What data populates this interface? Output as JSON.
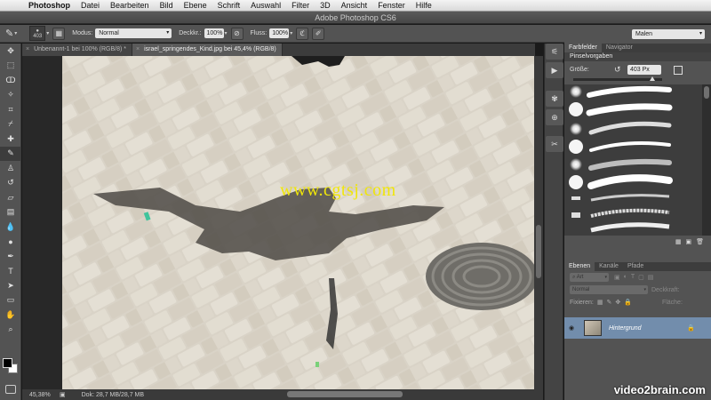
{
  "menubar": {
    "items": [
      {
        "label": "Photoshop"
      },
      {
        "label": "Datei"
      },
      {
        "label": "Bearbeiten"
      },
      {
        "label": "Bild"
      },
      {
        "label": "Ebene"
      },
      {
        "label": "Schrift"
      },
      {
        "label": "Auswahl"
      },
      {
        "label": "Filter"
      },
      {
        "label": "3D"
      },
      {
        "label": "Ansicht"
      },
      {
        "label": "Fenster"
      },
      {
        "label": "Hilfe"
      }
    ]
  },
  "window": {
    "title": "Adobe Photoshop CS6"
  },
  "options": {
    "brush_size": "403",
    "mode_label": "Modus:",
    "mode_value": "Normal",
    "opacity_label": "Deckkr.:",
    "opacity_value": "100%",
    "flow_label": "Fluss:",
    "flow_value": "100%",
    "workspace": "Malen"
  },
  "tabs": [
    {
      "label": "Unbenannt-1 bei 100% (RGB/8) *",
      "active": false
    },
    {
      "label": "israel_springendes_Kind.jpg bei 45,4% (RGB/8)",
      "active": true
    }
  ],
  "canvas": {
    "watermark": "www.cgtsj.com"
  },
  "status": {
    "zoom": "45,38%",
    "doc": "Dok: 28,7 MB/28,7 MB"
  },
  "panels": {
    "swatch_tabs": [
      "Farbfelder",
      "Navigator"
    ],
    "brush_title": "Pinselvorgaben",
    "size_label": "Größe:",
    "size_value": "403 Px",
    "layer_tabs": [
      "Ebenen",
      "Kanäle",
      "Pfade"
    ],
    "filter_kind": "Art",
    "blend_mode": "Normal",
    "opacity_label": "Deckkraft:",
    "lock_label": "Fixieren:",
    "fill_label": "Fläche:",
    "layer_name": "Hintergrund"
  },
  "brand": "video2brain.com",
  "icons": {
    "apple": "apple-icon",
    "brush": "brush-icon",
    "eye": "eye-icon",
    "lock": "lock-icon"
  }
}
